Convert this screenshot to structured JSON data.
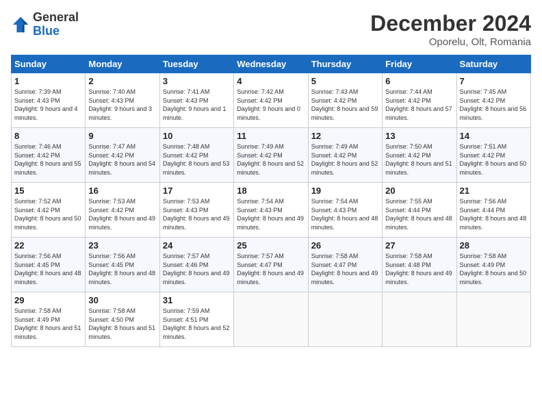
{
  "header": {
    "logo_general": "General",
    "logo_blue": "Blue",
    "month_title": "December 2024",
    "location": "Oporelu, Olt, Romania"
  },
  "weekdays": [
    "Sunday",
    "Monday",
    "Tuesday",
    "Wednesday",
    "Thursday",
    "Friday",
    "Saturday"
  ],
  "weeks": [
    [
      {
        "day": "1",
        "sunrise": "7:39 AM",
        "sunset": "4:43 PM",
        "daylight": "9 hours and 4 minutes."
      },
      {
        "day": "2",
        "sunrise": "7:40 AM",
        "sunset": "4:43 PM",
        "daylight": "9 hours and 3 minutes."
      },
      {
        "day": "3",
        "sunrise": "7:41 AM",
        "sunset": "4:43 PM",
        "daylight": "9 hours and 1 minute."
      },
      {
        "day": "4",
        "sunrise": "7:42 AM",
        "sunset": "4:42 PM",
        "daylight": "9 hours and 0 minutes."
      },
      {
        "day": "5",
        "sunrise": "7:43 AM",
        "sunset": "4:42 PM",
        "daylight": "8 hours and 59 minutes."
      },
      {
        "day": "6",
        "sunrise": "7:44 AM",
        "sunset": "4:42 PM",
        "daylight": "8 hours and 57 minutes."
      },
      {
        "day": "7",
        "sunrise": "7:45 AM",
        "sunset": "4:42 PM",
        "daylight": "8 hours and 56 minutes."
      }
    ],
    [
      {
        "day": "8",
        "sunrise": "7:46 AM",
        "sunset": "4:42 PM",
        "daylight": "8 hours and 55 minutes."
      },
      {
        "day": "9",
        "sunrise": "7:47 AM",
        "sunset": "4:42 PM",
        "daylight": "8 hours and 54 minutes."
      },
      {
        "day": "10",
        "sunrise": "7:48 AM",
        "sunset": "4:42 PM",
        "daylight": "8 hours and 53 minutes."
      },
      {
        "day": "11",
        "sunrise": "7:49 AM",
        "sunset": "4:42 PM",
        "daylight": "8 hours and 52 minutes."
      },
      {
        "day": "12",
        "sunrise": "7:49 AM",
        "sunset": "4:42 PM",
        "daylight": "8 hours and 52 minutes."
      },
      {
        "day": "13",
        "sunrise": "7:50 AM",
        "sunset": "4:42 PM",
        "daylight": "8 hours and 51 minutes."
      },
      {
        "day": "14",
        "sunrise": "7:51 AM",
        "sunset": "4:42 PM",
        "daylight": "8 hours and 50 minutes."
      }
    ],
    [
      {
        "day": "15",
        "sunrise": "7:52 AM",
        "sunset": "4:42 PM",
        "daylight": "8 hours and 50 minutes."
      },
      {
        "day": "16",
        "sunrise": "7:53 AM",
        "sunset": "4:42 PM",
        "daylight": "8 hours and 49 minutes."
      },
      {
        "day": "17",
        "sunrise": "7:53 AM",
        "sunset": "4:43 PM",
        "daylight": "8 hours and 49 minutes."
      },
      {
        "day": "18",
        "sunrise": "7:54 AM",
        "sunset": "4:43 PM",
        "daylight": "8 hours and 49 minutes."
      },
      {
        "day": "19",
        "sunrise": "7:54 AM",
        "sunset": "4:43 PM",
        "daylight": "8 hours and 48 minutes."
      },
      {
        "day": "20",
        "sunrise": "7:55 AM",
        "sunset": "4:44 PM",
        "daylight": "8 hours and 48 minutes."
      },
      {
        "day": "21",
        "sunrise": "7:56 AM",
        "sunset": "4:44 PM",
        "daylight": "8 hours and 48 minutes."
      }
    ],
    [
      {
        "day": "22",
        "sunrise": "7:56 AM",
        "sunset": "4:45 PM",
        "daylight": "8 hours and 48 minutes."
      },
      {
        "day": "23",
        "sunrise": "7:56 AM",
        "sunset": "4:45 PM",
        "daylight": "8 hours and 48 minutes."
      },
      {
        "day": "24",
        "sunrise": "7:57 AM",
        "sunset": "4:46 PM",
        "daylight": "8 hours and 49 minutes."
      },
      {
        "day": "25",
        "sunrise": "7:57 AM",
        "sunset": "4:47 PM",
        "daylight": "8 hours and 49 minutes."
      },
      {
        "day": "26",
        "sunrise": "7:58 AM",
        "sunset": "4:47 PM",
        "daylight": "8 hours and 49 minutes."
      },
      {
        "day": "27",
        "sunrise": "7:58 AM",
        "sunset": "4:48 PM",
        "daylight": "8 hours and 49 minutes."
      },
      {
        "day": "28",
        "sunrise": "7:58 AM",
        "sunset": "4:49 PM",
        "daylight": "8 hours and 50 minutes."
      }
    ],
    [
      {
        "day": "29",
        "sunrise": "7:58 AM",
        "sunset": "4:49 PM",
        "daylight": "8 hours and 51 minutes."
      },
      {
        "day": "30",
        "sunrise": "7:58 AM",
        "sunset": "4:50 PM",
        "daylight": "8 hours and 51 minutes."
      },
      {
        "day": "31",
        "sunrise": "7:59 AM",
        "sunset": "4:51 PM",
        "daylight": "8 hours and 52 minutes."
      },
      null,
      null,
      null,
      null
    ]
  ],
  "labels": {
    "sunrise": "Sunrise:",
    "sunset": "Sunset:",
    "daylight": "Daylight:"
  }
}
